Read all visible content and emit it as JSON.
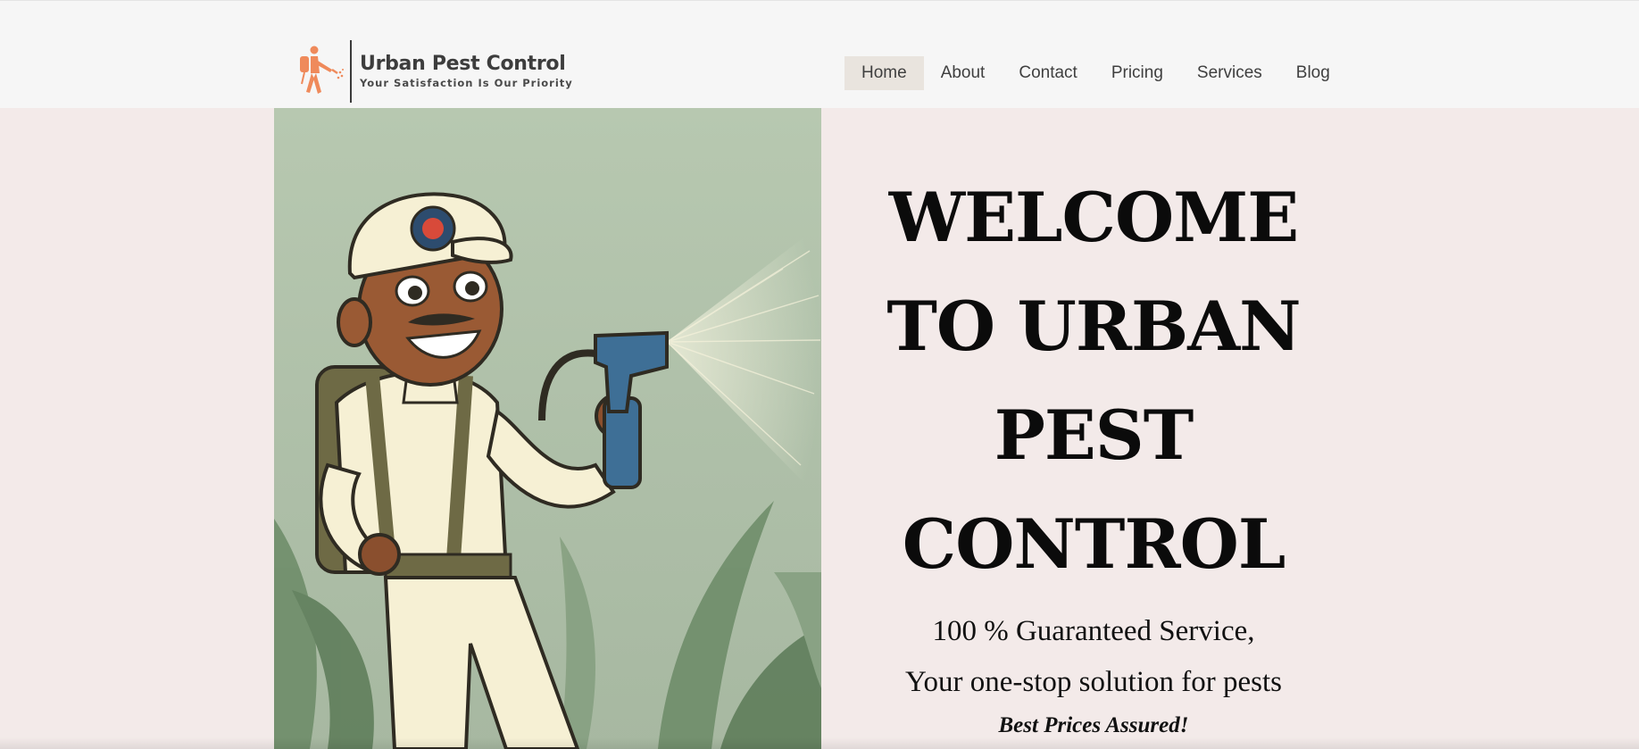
{
  "brand": {
    "name": "Urban Pest Control",
    "tagline": "Your Satisfaction Is Our Priority",
    "accent_color": "#ef8a5b",
    "logo_icon": "pest-sprayer-figure-icon"
  },
  "nav": {
    "items": [
      {
        "label": "Home",
        "active": true
      },
      {
        "label": "About",
        "active": false
      },
      {
        "label": "Contact",
        "active": false
      },
      {
        "label": "Pricing",
        "active": false
      },
      {
        "label": "Services",
        "active": false
      },
      {
        "label": "Blog",
        "active": false
      }
    ]
  },
  "hero": {
    "image_subject": "cartoon-pest-control-technician-spraying",
    "title_lines": [
      "WELCOME",
      "TO URBAN",
      "PEST",
      "CONTROL"
    ],
    "subtitle_line1": "100 % Guaranteed Service,",
    "subtitle_line2": "Your one-stop solution for pests",
    "note": "Best Prices Assured!"
  },
  "colors": {
    "header_bg": "#f6f6f6",
    "page_bg": "#f3eae9",
    "active_nav_bg": "#e9e4de"
  }
}
